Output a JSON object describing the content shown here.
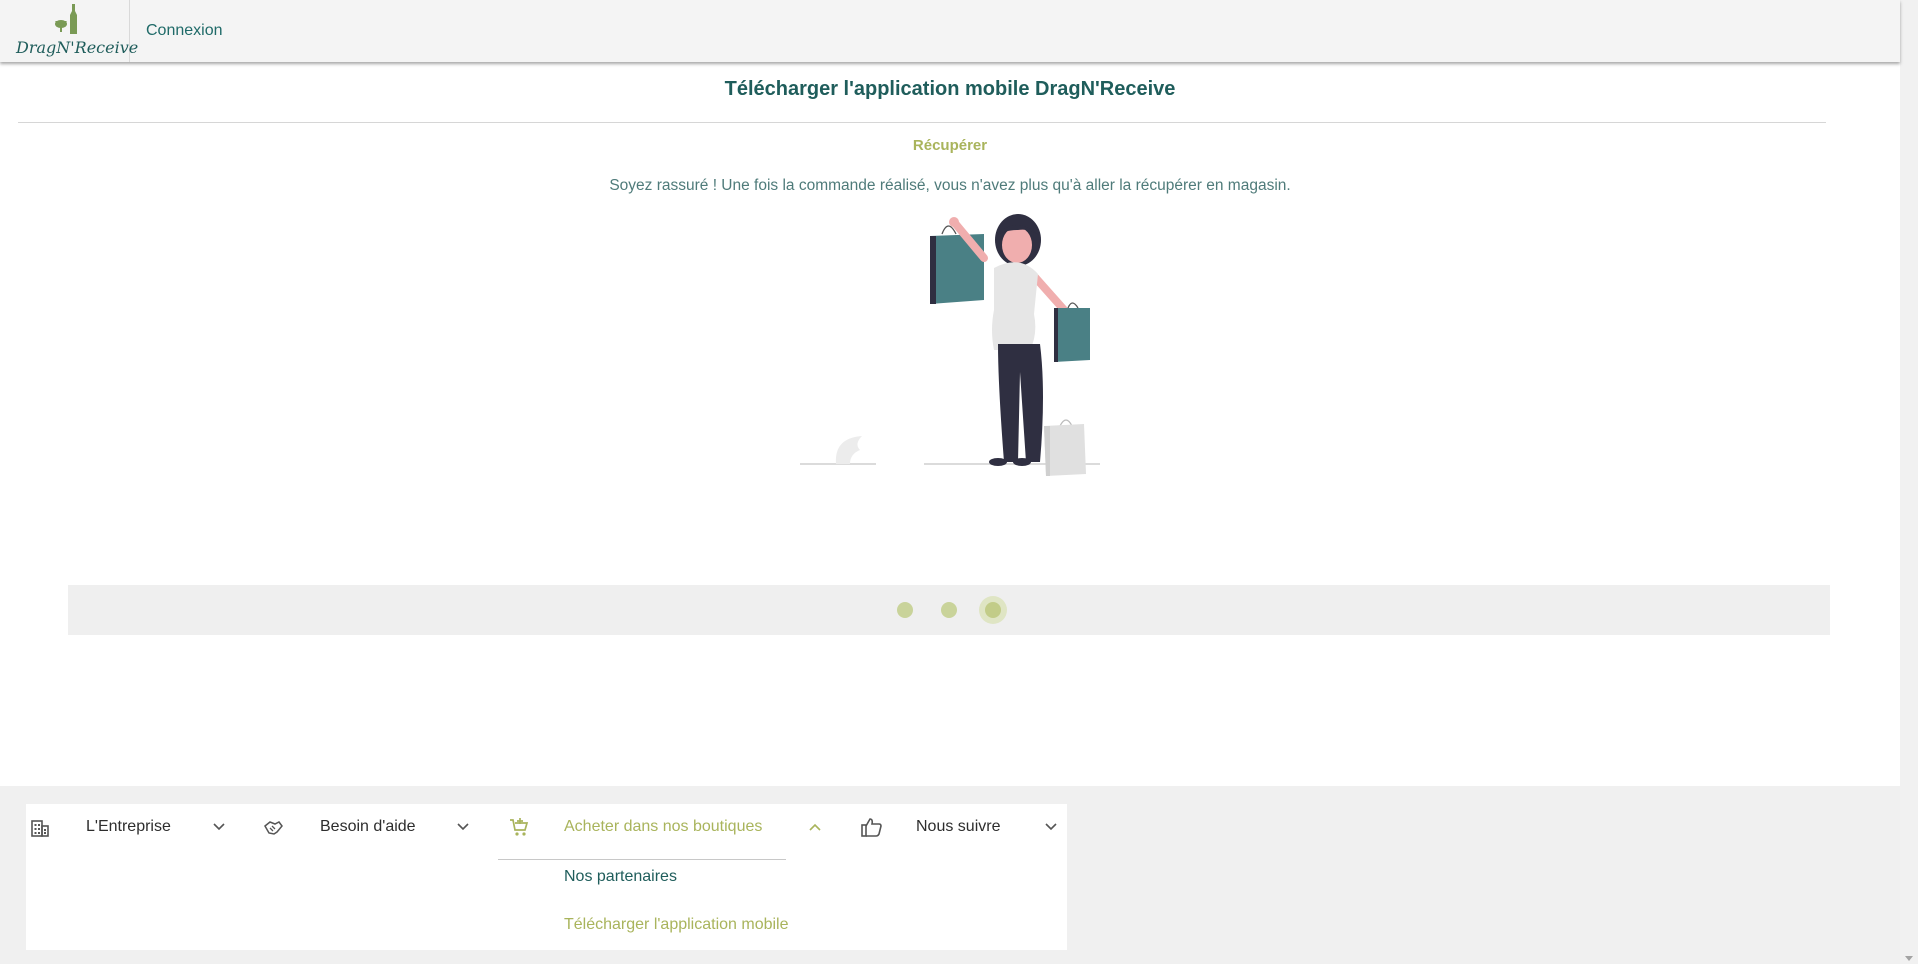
{
  "header": {
    "logo_text": "DragN'Receive",
    "login_link": "Connexion"
  },
  "main": {
    "title": "Télécharger l'application mobile DragN'Receive",
    "slide_title": "Récupérer",
    "slide_description": "Soyez rassuré ! Une fois la commande réalisé, vous n'avez plus qu'à aller la récupérer en magasin.",
    "carousel": {
      "slide_count": 3,
      "active_index": 2
    }
  },
  "footer": {
    "menus": [
      {
        "label": "L'Entreprise",
        "icon": "building-icon",
        "expanded": false
      },
      {
        "label": "Besoin d'aide",
        "icon": "handshake-icon",
        "expanded": false
      },
      {
        "label": "Acheter dans nos boutiques",
        "icon": "cart-icon",
        "expanded": true
      },
      {
        "label": "Nous suivre",
        "icon": "thumbs-up-icon",
        "expanded": false
      }
    ],
    "submenu": [
      {
        "label": "Nos partenaires"
      },
      {
        "label": "Télécharger l'application mobile"
      }
    ]
  },
  "colors": {
    "brand_teal": "#1f5d5b",
    "accent_olive": "#a9b45c",
    "bag_teal": "#4a8085"
  }
}
